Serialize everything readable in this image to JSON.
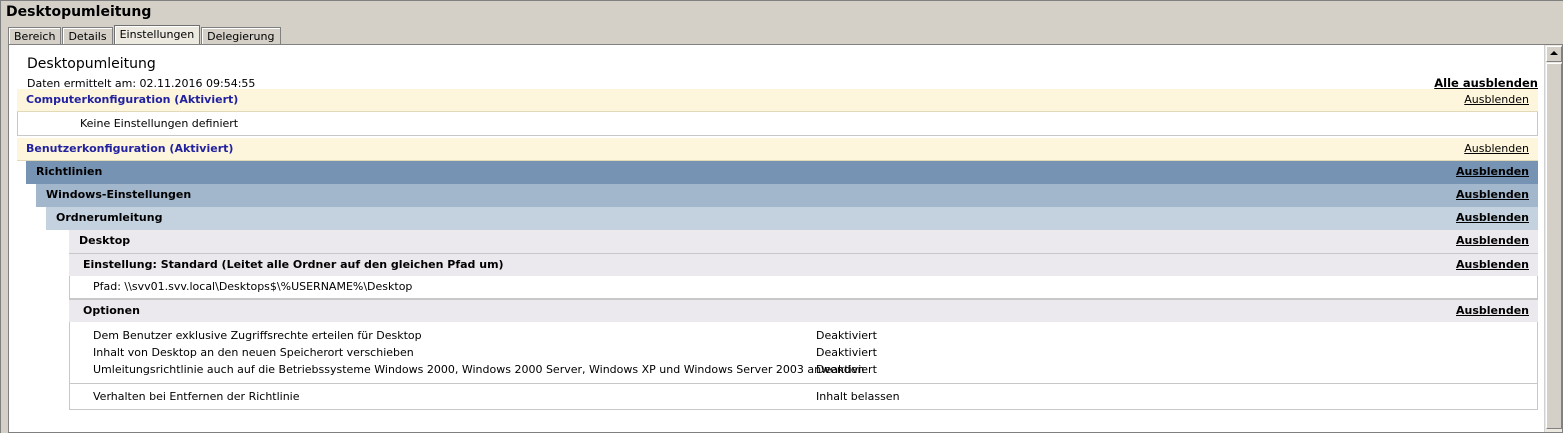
{
  "window": {
    "title": "Desktopumleitung"
  },
  "tabs": [
    "Bereich",
    "Details",
    "Einstellungen",
    "Delegierung"
  ],
  "report": {
    "title": "Desktopumleitung",
    "date": "Daten ermittelt am: 02.11.2016 09:54:55",
    "hide_all": "Alle ausblenden",
    "hide": "Ausblenden"
  },
  "computer": {
    "heading": "Computerkonfiguration (Aktiviert)",
    "note": "Keine Einstellungen definiert"
  },
  "user": {
    "heading": "Benutzerkonfiguration (Aktiviert)",
    "policies": "Richtlinien",
    "windows_settings": "Windows-Einstellungen",
    "folder_redirection": "Ordnerumleitung",
    "desktop": "Desktop",
    "setting": "Einstellung: Standard (Leitet alle Ordner auf den gleichen Pfad um)",
    "path": "Pfad: \\\\svv01.svv.local\\Desktops$\\%USERNAME%\\Desktop",
    "options": "Optionen",
    "options_rows": [
      {
        "name": "Dem Benutzer exklusive Zugriffsrechte erteilen für Desktop",
        "value": "Deaktiviert"
      },
      {
        "name": "Inhalt von Desktop an den neuen Speicherort verschieben",
        "value": "Deaktiviert"
      },
      {
        "name": "Umleitungsrichtlinie auch auf die Betriebssysteme Windows 2000, Windows 2000 Server, Windows XP und Windows Server 2003 anwenden",
        "value": "Deaktiviert"
      }
    ],
    "removal": {
      "name": "Verhalten bei Entfernen der Richtlinie",
      "value": "Inhalt belassen"
    }
  }
}
